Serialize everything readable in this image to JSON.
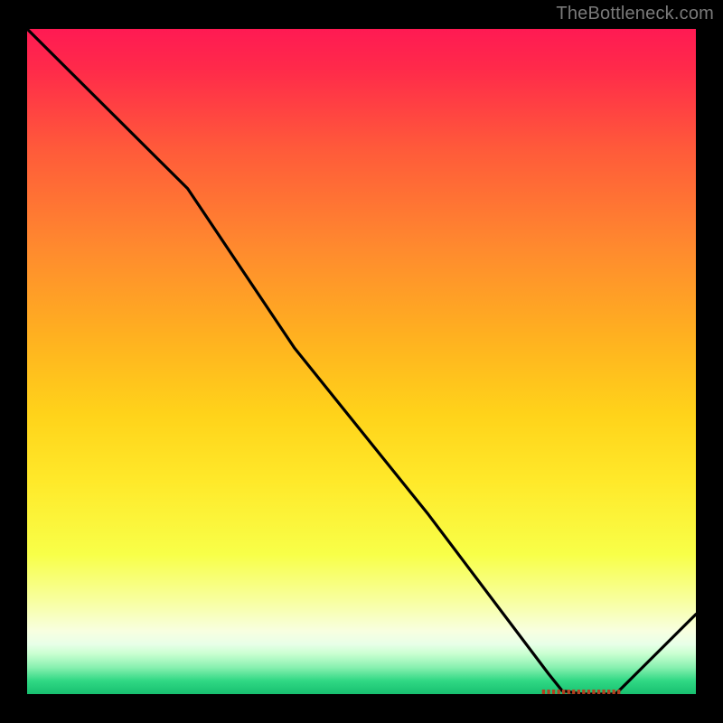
{
  "watermark": "TheBottleneck.com",
  "colors": {
    "background": "#000000",
    "curve": "#000000",
    "watermark": "#7a7a7a",
    "marker": "#b34020"
  },
  "chart_data": {
    "type": "line",
    "title": "",
    "xlabel": "",
    "ylabel": "",
    "xlim": [
      0,
      100
    ],
    "ylim": [
      0,
      100
    ],
    "grid": false,
    "legend": false,
    "series": [
      {
        "name": "bottleneck-curve",
        "x": [
          0,
          10,
          20,
          24,
          40,
          60,
          78,
          80,
          83,
          88,
          95,
          100
        ],
        "y": [
          100,
          90,
          80,
          76,
          52,
          27,
          3,
          0.5,
          0,
          0,
          7,
          12
        ]
      }
    ],
    "markers": {
      "name": "optimal-range",
      "y": 0,
      "x_start": 77,
      "x_end": 89
    },
    "background_gradient": {
      "orientation": "vertical",
      "stops": [
        {
          "pos": 0.0,
          "color": "#ff1a53"
        },
        {
          "pos": 0.18,
          "color": "#ff5a3a"
        },
        {
          "pos": 0.46,
          "color": "#ffb020"
        },
        {
          "pos": 0.68,
          "color": "#ffe92a"
        },
        {
          "pos": 0.9,
          "color": "#f8ffe0"
        },
        {
          "pos": 1.0,
          "color": "#18c070"
        }
      ]
    }
  }
}
